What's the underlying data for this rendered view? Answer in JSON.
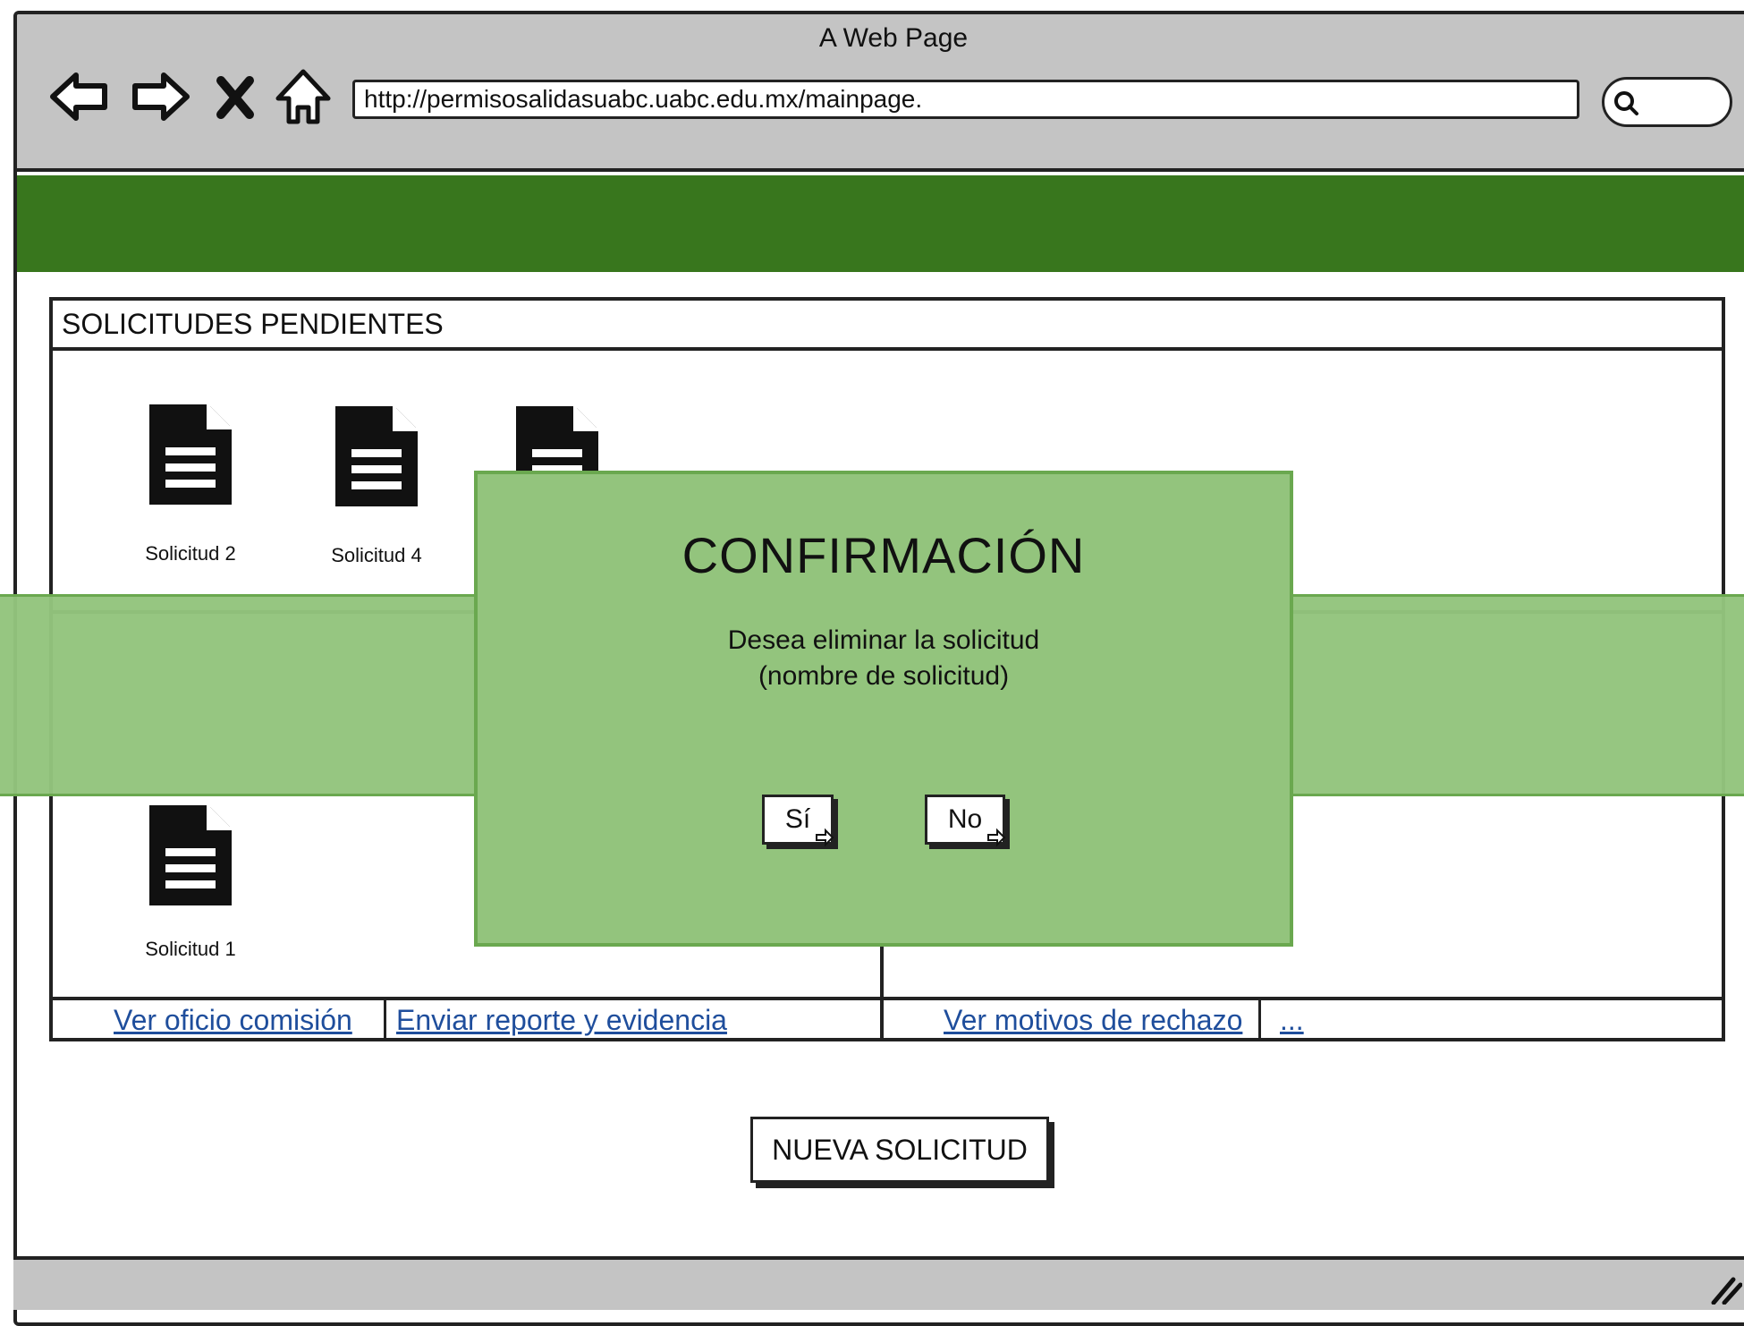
{
  "window": {
    "title": "A Web Page"
  },
  "toolbar": {
    "url": "http://permisosalidasuabc.uabc.edu.mx/mainpage.",
    "icons": [
      "back-arrow-icon",
      "forward-arrow-icon",
      "close-x-icon",
      "home-icon",
      "search-icon"
    ]
  },
  "panel": {
    "header": "SOLICITUDES PENDIENTES",
    "documents_top": [
      {
        "label": "Solicitud 2",
        "icon": "document-icon"
      },
      {
        "label": "Solicitud 4",
        "icon": "document-icon"
      },
      {
        "label": "",
        "icon": "document-icon"
      }
    ],
    "documents_bottom": [
      {
        "label": "Solicitud 1",
        "icon": "document-icon"
      }
    ],
    "links": {
      "ver_oficio": "Ver oficio comisión",
      "enviar_reporte": "Enviar reporte y evidencia",
      "ver_motivos": "Ver motivos de rechazo",
      "more": "..."
    }
  },
  "modal": {
    "title": "CONFIRMACIÓN",
    "message_line1": "Desea eliminar la solicitud",
    "message_line2": "(nombre de solicitud)",
    "yes_label": "Sí",
    "no_label": "No"
  },
  "actions": {
    "new_request": "NUEVA SOLICITUD"
  },
  "colors": {
    "header_green": "#38761d",
    "modal_green": "#93c47d",
    "link_blue": "#1f4e9c",
    "chrome_gray": "#c4c4c4"
  }
}
